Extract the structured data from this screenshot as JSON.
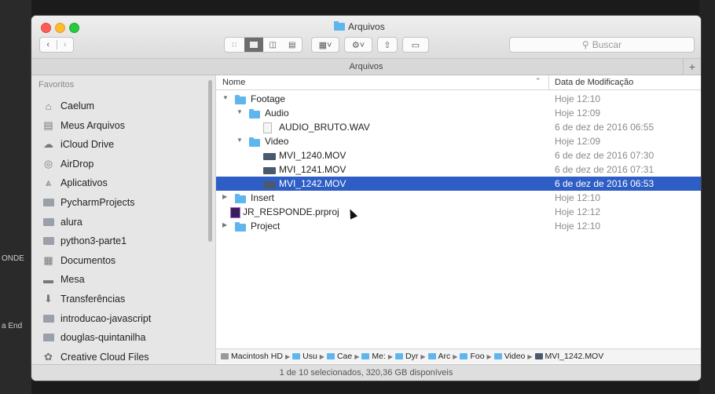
{
  "window": {
    "title": "Arquivos",
    "tab_label": "Arquivos",
    "search_placeholder": "Buscar",
    "status": "1 de 10 selecionados, 320,36 GB disponíveis"
  },
  "background": {
    "left_labels": [
      "ONDE",
      "a End"
    ]
  },
  "sidebar": {
    "heading": "Favoritos",
    "items": [
      {
        "label": "Caelum",
        "icon": "home-icon"
      },
      {
        "label": "Meus Arquivos",
        "icon": "all-files-icon"
      },
      {
        "label": "iCloud Drive",
        "icon": "cloud-icon"
      },
      {
        "label": "AirDrop",
        "icon": "airdrop-icon"
      },
      {
        "label": "Aplicativos",
        "icon": "applications-icon"
      },
      {
        "label": "PycharmProjects",
        "icon": "folder-icon"
      },
      {
        "label": "alura",
        "icon": "folder-icon"
      },
      {
        "label": "python3-parte1",
        "icon": "folder-icon"
      },
      {
        "label": "Documentos",
        "icon": "documents-icon"
      },
      {
        "label": "Mesa",
        "icon": "desktop-icon"
      },
      {
        "label": "Transferências",
        "icon": "downloads-icon"
      },
      {
        "label": "introducao-javascript",
        "icon": "folder-icon"
      },
      {
        "label": "douglas-quintanilha",
        "icon": "folder-icon"
      },
      {
        "label": "Creative Cloud Files",
        "icon": "creative-cloud-icon"
      }
    ]
  },
  "columns": {
    "name": "Nome",
    "date": "Data de Modificação"
  },
  "files": [
    {
      "name": "Footage",
      "date": "Hoje 12:10",
      "type": "folder",
      "level": 0,
      "expanded": true
    },
    {
      "name": "Audio",
      "date": "Hoje 12:09",
      "type": "folder",
      "level": 1,
      "expanded": true
    },
    {
      "name": "AUDIO_BRUTO.WAV",
      "date": "6 de dez de 2016 06:55",
      "type": "wav",
      "level": 2
    },
    {
      "name": "Video",
      "date": "Hoje 12:09",
      "type": "folder",
      "level": 1,
      "expanded": true
    },
    {
      "name": "MVI_1240.MOV",
      "date": "6 de dez de 2016 07:30",
      "type": "mov",
      "level": 2
    },
    {
      "name": "MVI_1241.MOV",
      "date": "6 de dez de 2016 07:31",
      "type": "mov",
      "level": 2
    },
    {
      "name": "MVI_1242.MOV",
      "date": "6 de dez de 2016 06:53",
      "type": "mov",
      "level": 2,
      "selected": true
    },
    {
      "name": "Insert",
      "date": "Hoje 12:10",
      "type": "folder",
      "level": 0,
      "expanded": false
    },
    {
      "name": "JR_RESPONDE.prproj",
      "date": "Hoje 12:12",
      "type": "prproj",
      "level": 0
    },
    {
      "name": "Project",
      "date": "Hoje 12:10",
      "type": "folder",
      "level": 0,
      "expanded": false
    }
  ],
  "path_bar": [
    "Macintosh HD",
    "Usu",
    "Cae",
    "Me:",
    "Dyr",
    "Arc",
    "Foo",
    "Video",
    "MVI_1242.MOV"
  ],
  "colors": {
    "selection": "#2e5ec5",
    "folder": "#5fb6ee"
  }
}
